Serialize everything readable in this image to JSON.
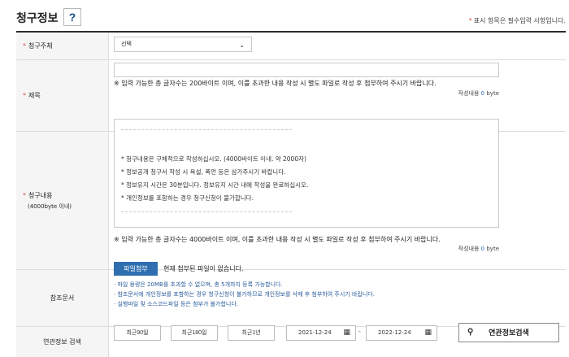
{
  "header": {
    "title": "청구정보",
    "help_label": "?",
    "required_note": "표시 항목은 필수입력 사항입니다.",
    "required_mark": "*"
  },
  "fields": {
    "subject": {
      "label": "청구주체",
      "select_value": "선택"
    },
    "title": {
      "label": "제목",
      "value": "",
      "note": "※ 입력 가능한 총 글자수는 200바이트 이며, 이를 초과한 내용 작성 시 별도 파일로 작성 후 첨부하여 주시기 바랍니다.",
      "count_prefix": "작성내용",
      "count_value": "0",
      "count_unit": "byte"
    },
    "content": {
      "label": "청구내용",
      "sublabel": "(4000byte 이내)",
      "guide": [
        "* 청구내용은 구체적으로 작성하십시오. (4000바이트 이내. 약 2000자)",
        "* 정보공개 청구서 작성 시 욕설, 폭언 등은 삼가주시기 바랍니다.",
        "* 정보유지 시간은 30분입니다. 정보유지 시간 내에 작성을 완료하십시오.",
        "* 개인정보를 포함하는 경우 청구신청이 불가합니다."
      ],
      "note": "※ 입력 가능한 총 글자수는 4000바이트 이며, 이를 초과한 내용 작성 시 별도 파일로 작성 후 첨부하여 주시기 바랍니다.",
      "count_prefix": "작성내용",
      "count_value": "0",
      "count_unit": "byte"
    },
    "attachment": {
      "label": "참조문서",
      "button": "파일첨부",
      "status": "현재 첨부된 파일이 없습니다.",
      "notes": [
        "· 파일 용량은 20MB를 초과할 수 없으며, 총 5개까지 등록 가능합니다.",
        "· 참조문서에 개인정보를 포함하는 경우 청구신청이 불가하므로 개인정보를 삭제 후 첨부하여 주시기 바랍니다.",
        "· 실행파일 및 소스코드파일 등은 첨부가 불가합니다."
      ]
    },
    "related_search": {
      "label": "연관정보 검색",
      "period_buttons": [
        "최근90일",
        "최근180일",
        "최근1년"
      ],
      "start_date": "2021-12-24",
      "end_date": "2022-12-24",
      "separator": "-",
      "search_button": "연관정보검색"
    }
  },
  "icons": {
    "chevron": "chevron-down-icon",
    "calendar": "calendar-icon",
    "search": "search-icon"
  },
  "colors": {
    "required": "#d9534f",
    "primary_button": "#2f6fb0",
    "note_text": "#2a5d9c"
  }
}
